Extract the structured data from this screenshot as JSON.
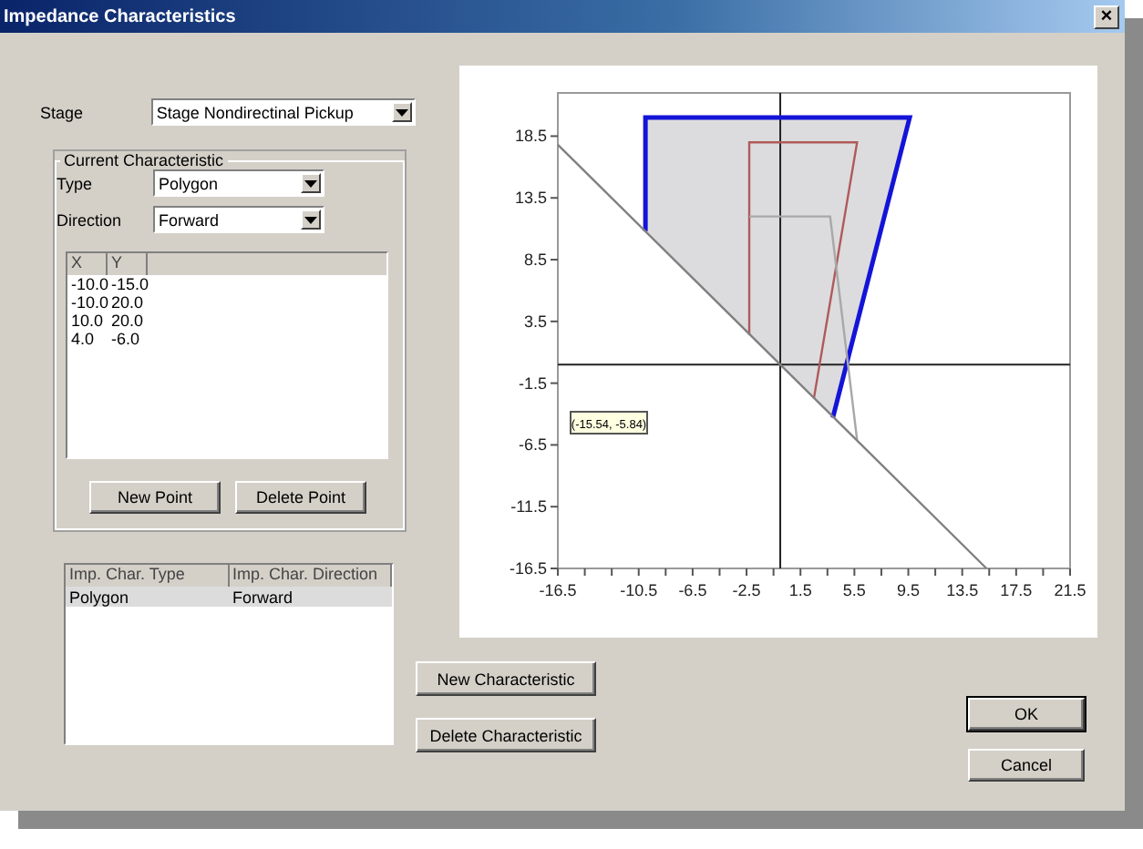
{
  "window": {
    "title": "Impedance Characteristics",
    "close": "×"
  },
  "stage": {
    "label": "Stage",
    "value": "Stage Nondirectinal Pickup"
  },
  "current_characteristic": {
    "title": "Current Characteristic",
    "fields": [
      {
        "label": "Type",
        "value": "Polygon"
      },
      {
        "label": "Direction",
        "value": "Forward"
      }
    ],
    "points": {
      "columns": [
        "X",
        "Y"
      ],
      "rows": [
        [
          "-10.0",
          "-15.0"
        ],
        [
          "-10.0",
          "20.0"
        ],
        [
          "10.0",
          "20.0"
        ],
        [
          "4.0",
          "-6.0"
        ]
      ]
    },
    "buttons": [
      {
        "label": "New Point"
      },
      {
        "label": "Delete Point"
      }
    ]
  },
  "characteristics": {
    "columns": [
      "Imp. Char. Type",
      "Imp. Char. Direction"
    ],
    "rows": [
      {
        "cells": [
          "Polygon",
          "Forward"
        ],
        "selected": true
      }
    ]
  },
  "chart": {
    "chart_data": {
      "type": "line",
      "xlim": [
        -16.5,
        21.5
      ],
      "ylim": [
        -16.5,
        22
      ],
      "xticks": [
        -16.5,
        -10.5,
        -6.5,
        -2.5,
        1.5,
        5.5,
        9.5,
        13.5,
        17.5,
        21.5
      ],
      "yticks": [
        -16.5,
        -11.5,
        -6.5,
        -1.5,
        3.5,
        8.5,
        13.5,
        18.5
      ],
      "series": [
        {
          "color": "#1414d8",
          "x": [
            -10,
            -10,
            9.6,
            3.9
          ],
          "values": [
            10.8,
            20,
            20,
            -4.3
          ]
        },
        {
          "color": "#b05a5a",
          "x": [
            -2.3,
            -2.3,
            5.7,
            2.5
          ],
          "values": [
            2.4,
            18,
            18,
            -2.7
          ]
        },
        {
          "color": "#a8a8a8",
          "x": [
            -2.3,
            3.7,
            5.7
          ],
          "values": [
            12,
            12,
            -6.1
          ]
        },
        {
          "color": "#808080",
          "x": [
            -16.5,
            15.3
          ],
          "values": [
            17.8,
            -16.5
          ]
        }
      ],
      "annotations": [
        "(-15.54, -5.84)"
      ]
    }
  },
  "characteristic_buttons": [
    {
      "label": "New Characteristic"
    },
    {
      "label": "Delete Characteristic"
    }
  ],
  "dialog_buttons": [
    {
      "label": "OK",
      "default": true
    },
    {
      "label": "Cancel",
      "default": false
    }
  ]
}
